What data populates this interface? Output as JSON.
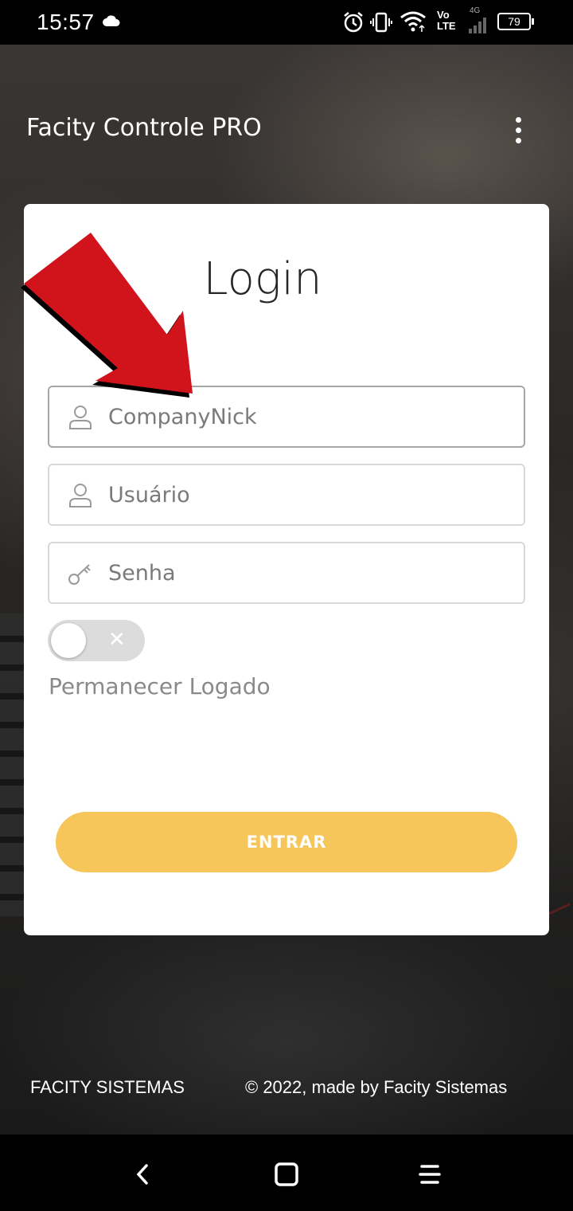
{
  "status_bar": {
    "time": "15:57",
    "network_label": "4G",
    "volte_top": "Vo",
    "volte_bottom": "LTE",
    "battery": "79",
    "icons": [
      "cloud-icon",
      "alarm-icon",
      "vibrate-icon",
      "wifi-icon",
      "signal-icon",
      "battery-icon"
    ]
  },
  "app_bar": {
    "title": "Facity Controle PRO",
    "menu_icon": "more-vert-icon"
  },
  "login": {
    "title": "Login",
    "company": {
      "value": "",
      "placeholder": "CompanyNick",
      "icon": "user-icon"
    },
    "user": {
      "value": "",
      "placeholder": "Usuário",
      "icon": "user-icon"
    },
    "password": {
      "value": "",
      "placeholder": "Senha",
      "icon": "key-icon"
    },
    "keep_logged": {
      "label": "Permanecer Logado",
      "on": false
    },
    "submit_label": "ENTRAR",
    "accent_color": "#f7c65a"
  },
  "footer": {
    "left": "FACITY SISTEMAS",
    "right": "© 2022, made by Facity Sistemas"
  },
  "nav_bar": {
    "icons": [
      "back-icon",
      "home-icon",
      "menu-icon"
    ]
  }
}
